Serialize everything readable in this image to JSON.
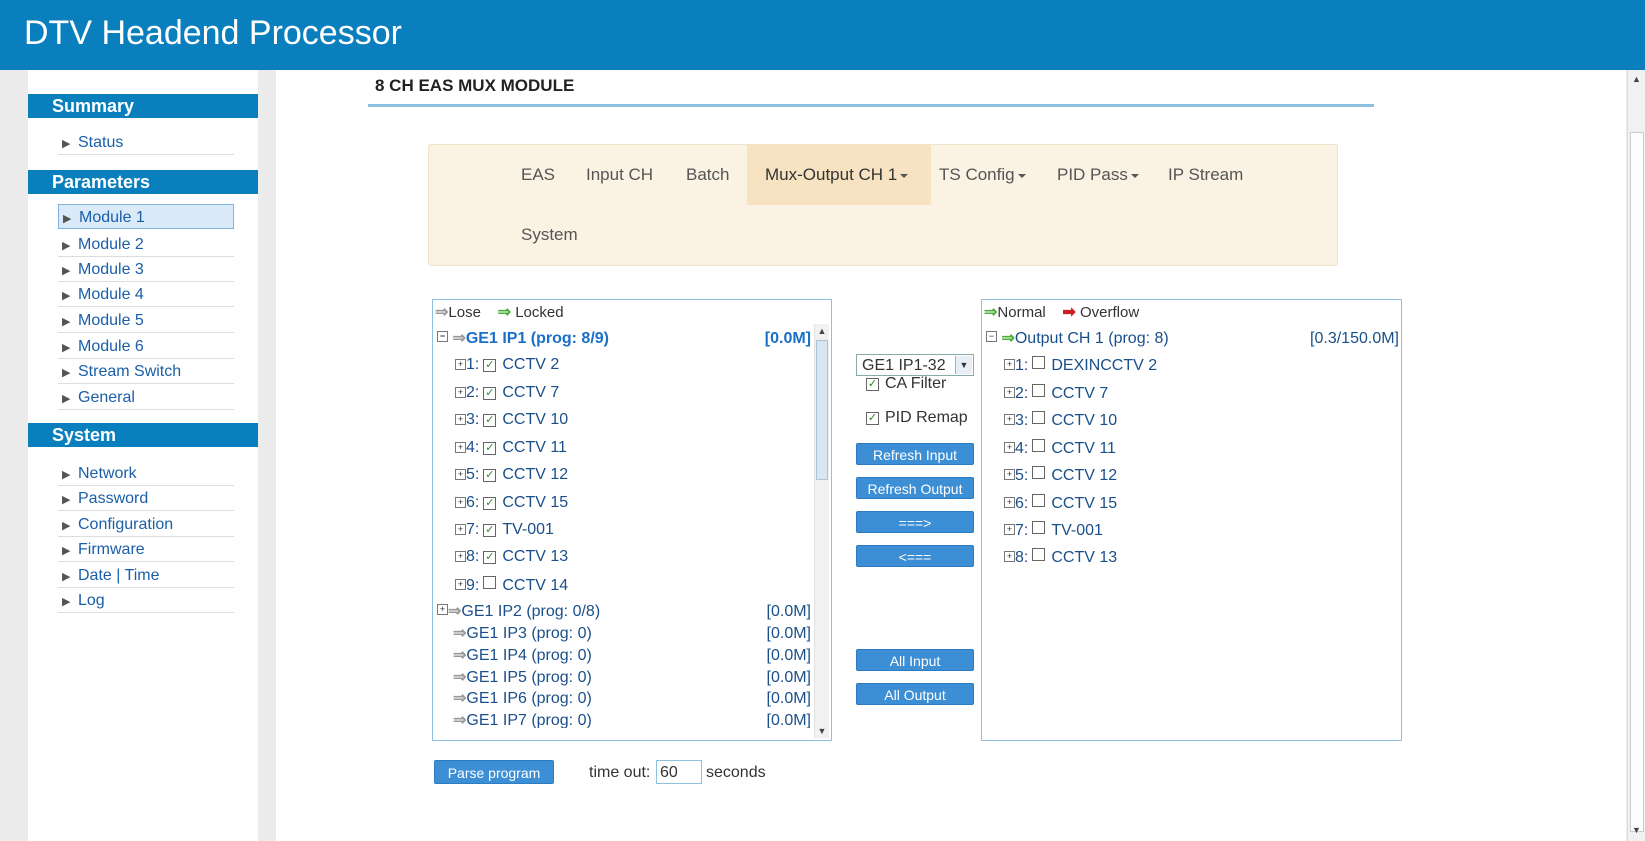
{
  "app_title": "DTV Headend Processor",
  "sidebar": {
    "summary_title": "Summary",
    "summary_items": [
      {
        "label": "Status"
      }
    ],
    "parameters_title": "Parameters",
    "parameters_items": [
      {
        "label": "Module 1"
      },
      {
        "label": "Module 2"
      },
      {
        "label": "Module 3"
      },
      {
        "label": "Module 4"
      },
      {
        "label": "Module 5"
      },
      {
        "label": "Module 6"
      },
      {
        "label": "Stream Switch"
      },
      {
        "label": "General"
      }
    ],
    "system_title": "System",
    "system_items": [
      {
        "label": "Network"
      },
      {
        "label": "Password"
      },
      {
        "label": "Configuration"
      },
      {
        "label": "Firmware"
      },
      {
        "label": "Date | Time"
      },
      {
        "label": "Log"
      }
    ]
  },
  "main": {
    "page_title": "8 CH EAS MUX MODULE",
    "tabs": [
      {
        "label": "EAS"
      },
      {
        "label": "Input CH"
      },
      {
        "label": "Batch"
      },
      {
        "label": "Mux-Output CH 1"
      },
      {
        "label": "TS Config"
      },
      {
        "label": "PID Pass"
      },
      {
        "label": "IP Stream"
      },
      {
        "label": "System"
      }
    ],
    "input_panel": {
      "legend_lose": "Lose",
      "legend_locked": "Locked",
      "group_label": "GE1 IP1 (prog: 8/9)",
      "group_rate": "[0.0M]",
      "programs": [
        {
          "num": "1:",
          "name": "CCTV 2",
          "checked": "✓"
        },
        {
          "num": "2:",
          "name": "CCTV 7",
          "checked": "✓"
        },
        {
          "num": "3:",
          "name": "CCTV 10",
          "checked": "✓"
        },
        {
          "num": "4:",
          "name": "CCTV 11",
          "checked": "✓"
        },
        {
          "num": "5:",
          "name": "CCTV 12",
          "checked": "✓"
        },
        {
          "num": "6:",
          "name": "CCTV 15",
          "checked": "✓"
        },
        {
          "num": "7:",
          "name": "TV-001",
          "checked": "✓"
        },
        {
          "num": "8:",
          "name": "CCTV 13",
          "checked": "✓"
        },
        {
          "num": "9:",
          "name": "CCTV 14",
          "checked": ""
        }
      ],
      "other_groups": [
        {
          "label": "GE1 IP2 (prog: 0/8)",
          "rate": "[0.0M]"
        },
        {
          "label": "GE1 IP3 (prog: 0)",
          "rate": "[0.0M]"
        },
        {
          "label": "GE1 IP4 (prog: 0)",
          "rate": "[0.0M]"
        },
        {
          "label": "GE1 IP5 (prog: 0)",
          "rate": "[0.0M]"
        },
        {
          "label": "GE1 IP6 (prog: 0)",
          "rate": "[0.0M]"
        },
        {
          "label": "GE1 IP7 (prog: 0)",
          "rate": "[0.0M]"
        }
      ]
    },
    "controls": {
      "select_value": "GE1 IP1-32",
      "ca_filter_label": "CA Filter",
      "pid_remap_label": "PID Remap",
      "refresh_input": "Refresh Input",
      "refresh_output": "Refresh Output",
      "add": "===>",
      "remove": "<===",
      "all_input": "All Input",
      "all_output": "All Output"
    },
    "output_panel": {
      "legend_normal": "Normal",
      "legend_overflow": "Overflow",
      "group_label": "Output CH 1 (prog: 8)",
      "group_rate": "[0.3/150.0M]",
      "programs": [
        {
          "num": "1:",
          "name": "DEXINCCTV 2"
        },
        {
          "num": "2:",
          "name": "CCTV 7"
        },
        {
          "num": "3:",
          "name": "CCTV 10"
        },
        {
          "num": "4:",
          "name": "CCTV 11"
        },
        {
          "num": "5:",
          "name": "CCTV 12"
        },
        {
          "num": "6:",
          "name": "CCTV 15"
        },
        {
          "num": "7:",
          "name": "TV-001"
        },
        {
          "num": "8:",
          "name": "CCTV 13"
        }
      ]
    },
    "parse_button": "Parse program",
    "timeout_label": "time out:",
    "timeout_value": "60",
    "timeout_unit": "seconds"
  }
}
